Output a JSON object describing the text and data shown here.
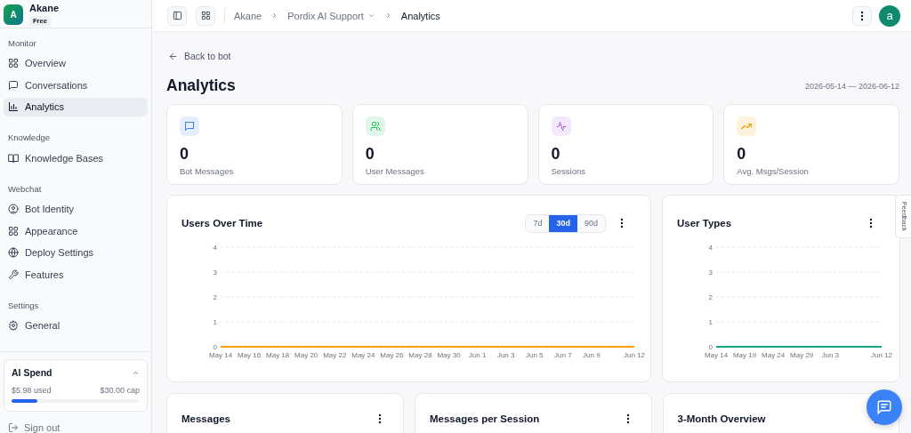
{
  "sidebar": {
    "workspace": {
      "avatar": "A",
      "name": "Akane",
      "plan": "Free"
    },
    "sections": [
      {
        "label": "Monitor",
        "items": [
          {
            "label": "Overview",
            "selected": false
          },
          {
            "label": "Conversations",
            "selected": false
          },
          {
            "label": "Analytics",
            "selected": true
          }
        ]
      },
      {
        "label": "Knowledge",
        "items": [
          {
            "label": "Knowledge Bases",
            "selected": false
          }
        ]
      },
      {
        "label": "Webchat",
        "items": [
          {
            "label": "Bot Identity",
            "selected": false
          },
          {
            "label": "Appearance",
            "selected": false
          },
          {
            "label": "Deploy Settings",
            "selected": false
          },
          {
            "label": "Features",
            "selected": false
          }
        ]
      },
      {
        "label": "Settings",
        "items": [
          {
            "label": "General",
            "selected": false
          }
        ]
      }
    ],
    "spend": {
      "title": "AI Spend",
      "expanded": true,
      "used": "$5.98 used",
      "cap": "$30.00 cap",
      "level": 0.2
    },
    "sign_out": "Sign out"
  },
  "topbar": {
    "breadcrumb": [
      {
        "label": "Akane",
        "dropdown": false
      },
      {
        "label": "Pordix AI Support",
        "dropdown": true
      },
      {
        "label": "Analytics",
        "dropdown": false
      }
    ],
    "avatar": "a"
  },
  "page": {
    "back": "Back to bot",
    "title": "Analytics",
    "date_range": "2026-05-14 — 2026-06-12"
  },
  "stats": [
    {
      "value": "0",
      "label": "Bot Messages",
      "color": "#3b82f6"
    },
    {
      "value": "0",
      "label": "User Messages",
      "color": "#22c55e"
    },
    {
      "value": "0",
      "label": "Sessions",
      "color": "#a855f7"
    },
    {
      "value": "0",
      "label": "Avg. Msgs/Session",
      "color": "#f59e0b"
    }
  ],
  "charts": [
    {
      "title": "Users Over Time",
      "periods": [
        {
          "label": "7d",
          "selected": false
        },
        {
          "label": "30d",
          "selected": true
        },
        {
          "label": "90d",
          "selected": false
        }
      ],
      "chart_data": {
        "type": "line",
        "categories": [
          "May 14",
          null,
          "May 16",
          null,
          "May 18",
          null,
          "May 20",
          null,
          "May 22",
          null,
          "May 24",
          null,
          "May 26",
          null,
          "May 28",
          null,
          "May 30",
          null,
          "Jun 1",
          null,
          "Jun 3",
          null,
          "Jun 5",
          null,
          "Jun 7",
          null,
          "Jun 9",
          null,
          null,
          "Jun 12"
        ],
        "series": [
          {
            "color": "#f59e0b",
            "values": [
              0,
              0,
              0,
              0,
              0,
              0,
              0,
              0,
              0,
              0,
              0,
              0,
              0,
              0,
              0,
              0,
              0,
              0,
              0,
              0,
              0,
              0,
              0,
              0,
              0,
              0,
              0,
              0,
              0,
              0
            ]
          }
        ],
        "ylim": [
          0,
          4
        ],
        "yticks": [
          0,
          1,
          2,
          3,
          4
        ],
        "grid": true
      }
    },
    {
      "title": "User Types",
      "chart_data": {
        "type": "line",
        "categories": [
          "May 14",
          null,
          null,
          null,
          null,
          "May 19",
          null,
          null,
          null,
          null,
          "May 24",
          null,
          null,
          null,
          null,
          "May 29",
          null,
          null,
          null,
          null,
          "Jun 3",
          null,
          null,
          null,
          null,
          null,
          null,
          null,
          null,
          "Jun 12"
        ],
        "series": [
          {
            "color": "#14a38b",
            "values": [
              0,
              0,
              0,
              0,
              0,
              0,
              0,
              0,
              0,
              0,
              0,
              0,
              0,
              0,
              0,
              0,
              0,
              0,
              0,
              0,
              0,
              0,
              0,
              0,
              0,
              0,
              0,
              0,
              0,
              0
            ]
          }
        ],
        "ylim": [
          0,
          4
        ],
        "yticks": [
          0,
          1,
          2,
          3,
          4
        ],
        "grid": true
      }
    }
  ],
  "bottom_cards": [
    {
      "title": "Messages"
    },
    {
      "title": "Messages per Session"
    },
    {
      "title": "3-Month Overview"
    }
  ],
  "feedback": "Feedback"
}
